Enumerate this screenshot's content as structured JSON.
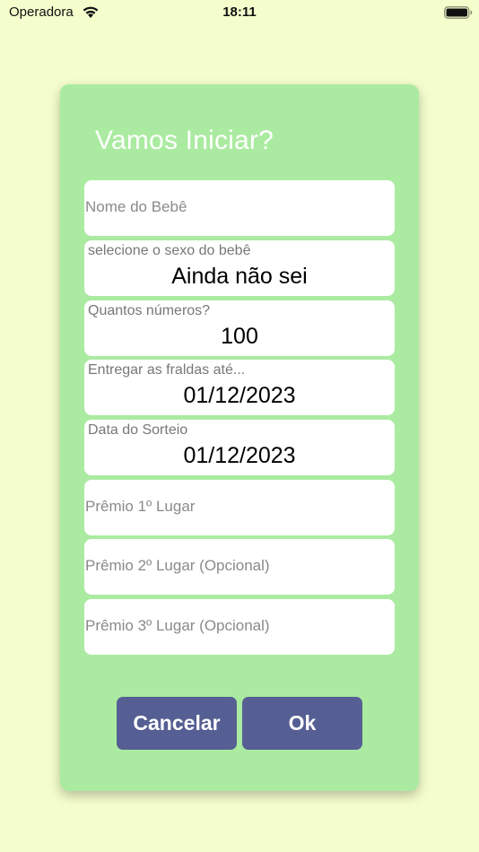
{
  "status_bar": {
    "carrier": "Operadora",
    "time": "18:11",
    "icons": [
      "wifi-icon",
      "battery-icon"
    ]
  },
  "dialog": {
    "title": "Vamos Iniciar?",
    "fields": {
      "baby_name": {
        "placeholder": "Nome do Bebê",
        "value": ""
      },
      "baby_sex": {
        "label": "selecione o sexo do bebê",
        "value": "Ainda não sei"
      },
      "numbers_count": {
        "label": "Quantos números?",
        "value": "100"
      },
      "delivery_date": {
        "label": "Entregar as fraldas até...",
        "value": "01/12/2023"
      },
      "draw_date": {
        "label": "Data do Sorteio",
        "value": "01/12/2023"
      },
      "prize_1": {
        "placeholder": "Prêmio 1º Lugar",
        "value": ""
      },
      "prize_2": {
        "placeholder": "Prêmio 2º Lugar (Opcional)",
        "value": ""
      },
      "prize_3": {
        "placeholder": "Prêmio 3º Lugar (Opcional)",
        "value": ""
      }
    },
    "buttons": {
      "cancel": "Cancelar",
      "ok": "Ok"
    }
  },
  "colors": {
    "background": "#f4fdcc",
    "card": "#abeba1",
    "button": "#565f93",
    "field": "#ffffff"
  }
}
